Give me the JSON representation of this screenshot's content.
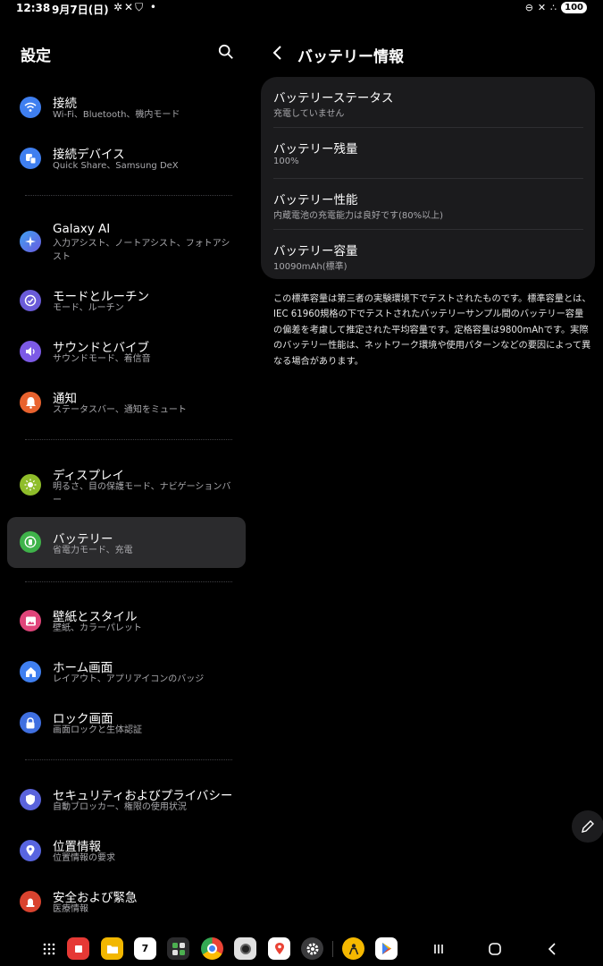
{
  "status_bar": {
    "time": "12:38",
    "date": "9月7日(日)",
    "notif_icons": "✲✕⛉ •",
    "battery": "100"
  },
  "settings": {
    "title": "設定",
    "items": [
      {
        "title": "接続",
        "sub": "Wi-Fi、Bluetooth、機内モード",
        "color": "#3f7ff0",
        "icon": "wifi-icon"
      },
      {
        "title": "接続デバイス",
        "sub": "Quick Share、Samsung DeX",
        "color": "#3f7ff0",
        "icon": "devices-icon"
      },
      {
        "title": "Galaxy AI",
        "sub": "入力アシスト、ノートアシスト、フォトアシスト",
        "color": "#4b6ee0",
        "icon": "sparkle-icon"
      },
      {
        "title": "モードとルーチン",
        "sub": "モード、ルーチン",
        "color": "#6a5bd8",
        "icon": "routine-icon"
      },
      {
        "title": "サウンドとバイブ",
        "sub": "サウンドモード、着信音",
        "color": "#7c5ae6",
        "icon": "sound-icon"
      },
      {
        "title": "通知",
        "sub": "ステータスバー、通知をミュート",
        "color": "#e8622e",
        "icon": "bell-icon"
      },
      {
        "title": "ディスプレイ",
        "sub": "明るさ、目の保護モード、ナビゲーションバー",
        "color": "#8fbd2a",
        "icon": "sun-icon"
      },
      {
        "title": "バッテリー",
        "sub": "省電力モード、充電",
        "color": "#3fb34a",
        "icon": "battery-icon"
      },
      {
        "title": "壁紙とスタイル",
        "sub": "壁紙、カラーパレット",
        "color": "#e0457a",
        "icon": "wallpaper-icon"
      },
      {
        "title": "ホーム画面",
        "sub": "レイアウト、アプリアイコンのバッジ",
        "color": "#3f7ff0",
        "icon": "home-icon"
      },
      {
        "title": "ロック画面",
        "sub": "画面ロックと生体認証",
        "color": "#3f6fe0",
        "icon": "lock-icon"
      },
      {
        "title": "セキュリティおよびプライバシー",
        "sub": "自動ブロッカー、権限の使用状況",
        "color": "#5a63dc",
        "icon": "shield-icon"
      },
      {
        "title": "位置情報",
        "sub": "位置情報の要求",
        "color": "#5865e0",
        "icon": "location-icon"
      },
      {
        "title": "安全および緊急",
        "sub": "医療情報",
        "color": "#d9432f",
        "icon": "emergency-icon"
      }
    ]
  },
  "battery_info": {
    "title": "バッテリー情報",
    "rows": [
      {
        "title": "バッテリーステータス",
        "value": "充電していません"
      },
      {
        "title": "バッテリー残量",
        "value": "100%"
      },
      {
        "title": "バッテリー性能",
        "value": "内蔵電池の充電能力は良好です(80%以上)"
      },
      {
        "title": "バッテリー容量",
        "value": "10090mAh(標準)"
      }
    ],
    "note": "この標準容量は第三者の実験環境下でテストされたものです。標準容量とは、IEC 61960規格の下でテストされたバッテリーサンプル間のバッテリー容量の偏差を考慮して推定された平均容量です。定格容量は9800mAhです。実際のバッテリー性能は、ネットワーク環境や使用パターンなどの要因によって異なる場合があります。"
  },
  "taskbar": {
    "calendar_day": "7",
    "apps": [
      "app-drawer-icon",
      "notes-app-icon",
      "my-files-icon",
      "calendar-icon",
      "apps-folder-icon",
      "chrome-icon",
      "camera-icon",
      "maps-icon",
      "settings-icon",
      "kakao-icon",
      "play-store-icon"
    ]
  }
}
